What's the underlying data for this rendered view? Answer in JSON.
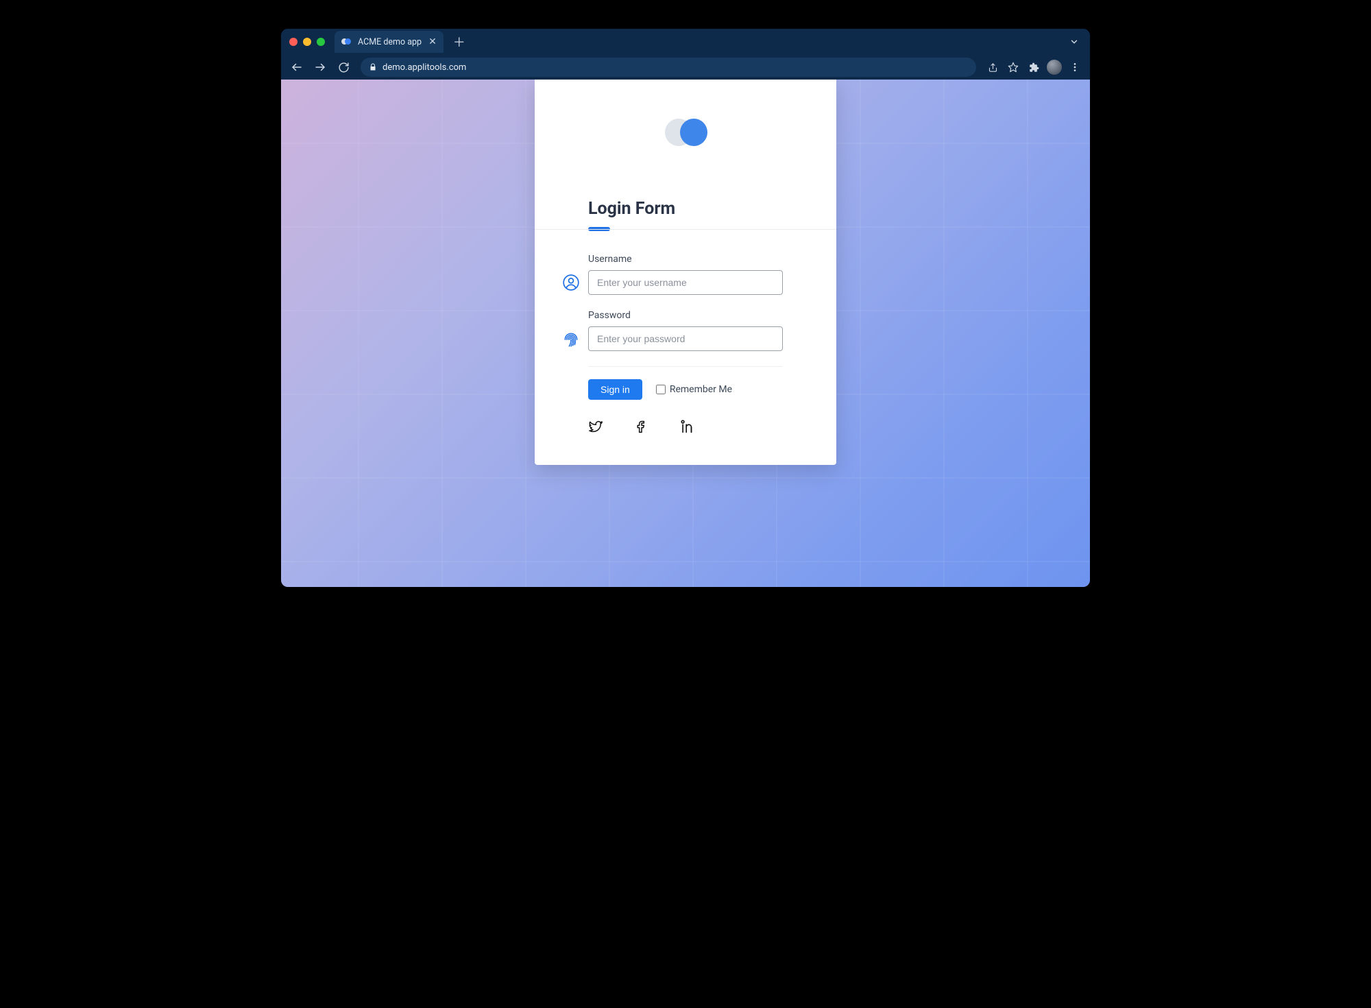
{
  "browser": {
    "tab_title": "ACME demo app",
    "url": "demo.applitools.com"
  },
  "form": {
    "title": "Login Form",
    "username_label": "Username",
    "username_placeholder": "Enter your username",
    "password_label": "Password",
    "password_placeholder": "Enter your password",
    "signin_label": "Sign in",
    "remember_label": "Remember Me"
  }
}
